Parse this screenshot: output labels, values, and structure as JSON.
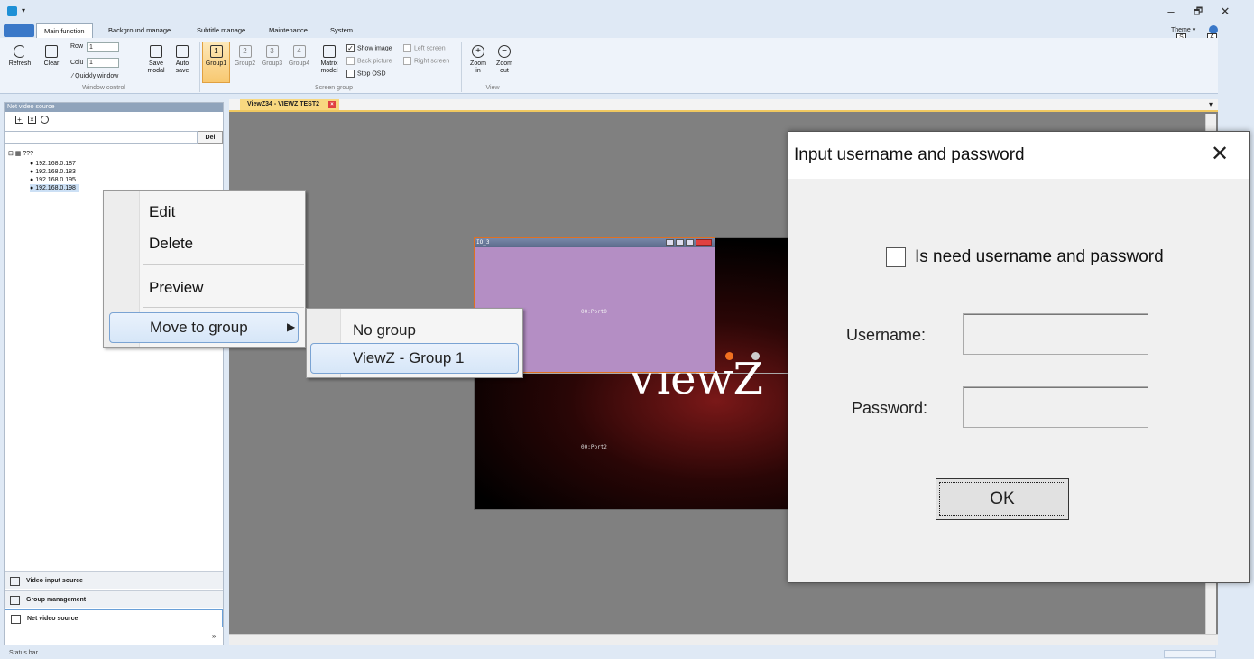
{
  "window": {
    "title_icon": "app-icon",
    "minimize": "–",
    "restore": "🗗",
    "close": "✕"
  },
  "tabs": [
    {
      "label": "Main function"
    },
    {
      "label": "Background manage"
    },
    {
      "label": "Subtitle manage"
    },
    {
      "label": "Maintenance"
    },
    {
      "label": "System"
    }
  ],
  "theme": {
    "label": "Theme",
    "s": "S",
    "a": "A"
  },
  "ribbon": {
    "refresh": "Refresh",
    "clear": "Clear",
    "row_label": "Row",
    "row_value": "1",
    "col_label": "Colu",
    "col_value": "1",
    "quick_window": "Quickly window",
    "save": "Save",
    "save2": "modal",
    "auto": "Auto",
    "auto2": "save",
    "window_control": "Window control",
    "groups": [
      "Group1",
      "Group2",
      "Group3",
      "Group4"
    ],
    "group_nums": [
      "1",
      "2",
      "3",
      "4"
    ],
    "matrix": "Matrix",
    "matrix2": "model",
    "show_image": "Show image",
    "back_picture": "Back picture",
    "stop_osd": "Stop OSD",
    "left_screen": "Left screen",
    "right_screen": "Right screen",
    "screen_group": "Screen group",
    "zoom_in": "Zoom",
    "zoom_in2": "in",
    "zoom_out": "Zoom",
    "zoom_out2": "out",
    "view": "View"
  },
  "left_panel": {
    "title": "Net video source",
    "del": "Del",
    "root": "???",
    "ips": [
      "192.168.0.187",
      "192.168.0.183",
      "192.168.0.195",
      "192.168.0.198"
    ],
    "nav": [
      "Video input source",
      "Group management",
      "Net video source"
    ]
  },
  "doc_tab": "ViewZ34 - VIEWZ TEST2",
  "video": {
    "win_title": "IO_3",
    "port0": "00:Port0",
    "port2": "00:Port2",
    "logo": "ViewZ"
  },
  "context_menu": {
    "edit": "Edit",
    "delete": "Delete",
    "preview": "Preview",
    "move": "Move to group"
  },
  "submenu": {
    "no_group": "No group",
    "group1": "ViewZ - Group 1"
  },
  "dialog": {
    "title": "Input username and password",
    "close": "✕",
    "checkbox": "Is need username and password",
    "username": "Username:",
    "password": "Password:",
    "ok": "OK"
  },
  "status": "Status bar"
}
